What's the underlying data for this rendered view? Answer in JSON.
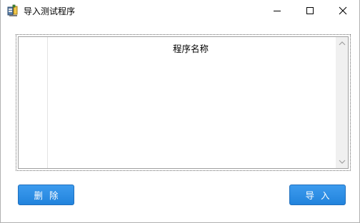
{
  "window": {
    "title": "导入测试程序",
    "controls": {
      "minimize": "minimize-icon",
      "maximize": "maximize-icon",
      "close": "close-icon"
    }
  },
  "list": {
    "columns": [
      "程序名称"
    ],
    "rows": []
  },
  "buttons": {
    "delete_label": "删除",
    "import_label": "导入"
  },
  "colors": {
    "button_bg": "#2e8ce3",
    "button_text": "#ffffff",
    "scrollbar_bg": "#f0f0f0"
  }
}
